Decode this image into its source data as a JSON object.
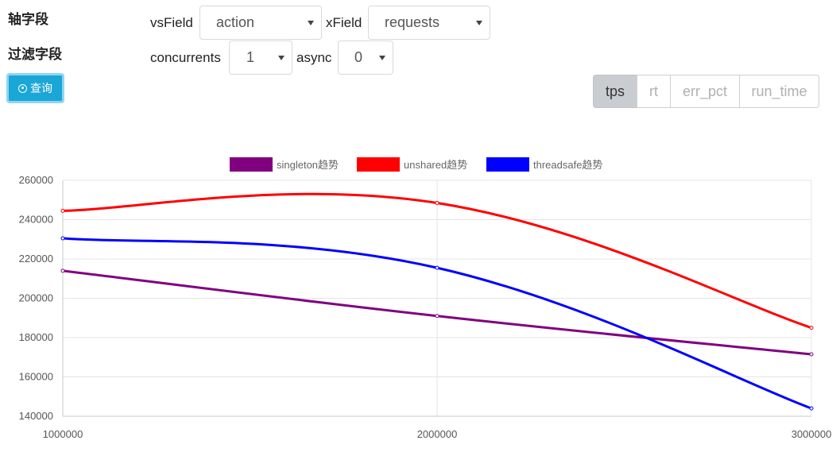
{
  "form": {
    "axis_label": "轴字段",
    "filter_label": "过滤字段",
    "vs_field": {
      "label": "vsField",
      "value": "action"
    },
    "x_field": {
      "label": "xField",
      "value": "requests"
    },
    "concurrents": {
      "label": "concurrents",
      "value": "1"
    },
    "async": {
      "label": "async",
      "value": "0"
    },
    "query_label": "查询"
  },
  "metric_tabs": [
    {
      "label": "tps",
      "active": true
    },
    {
      "label": "rt",
      "active": false
    },
    {
      "label": "err_pct",
      "active": false
    },
    {
      "label": "run_time",
      "active": false
    }
  ],
  "chart_data": {
    "type": "line",
    "x": [
      1000000,
      2000000,
      3000000
    ],
    "x_tick_labels": [
      "1000000",
      "2000000",
      "3000000"
    ],
    "ylim": [
      140000,
      260000
    ],
    "y_ticks": [
      140000,
      160000,
      180000,
      200000,
      220000,
      240000,
      260000
    ],
    "grid": true,
    "legend_position": "top-center",
    "series": [
      {
        "name": "singleton趋势",
        "color": "#800080",
        "values": [
          214000,
          191000,
          171500
        ]
      },
      {
        "name": "unshared趋势",
        "color": "#ff0000",
        "values": [
          244500,
          248500,
          185000
        ]
      },
      {
        "name": "threadsafe趋势",
        "color": "#0000ff",
        "values": [
          230500,
          215500,
          144000
        ]
      }
    ]
  }
}
